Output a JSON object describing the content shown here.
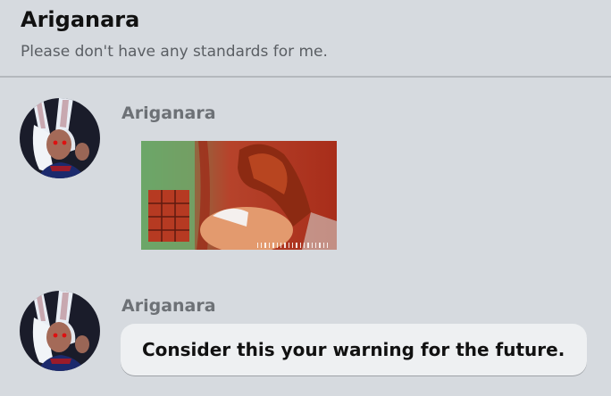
{
  "header": {
    "title": "Ariganara",
    "subtitle": "Please don't have any standards for me."
  },
  "messages": [
    {
      "sender": "Ariganara",
      "attachment": "image",
      "avatar_icon": "user-avatar"
    },
    {
      "sender": "Ariganara",
      "text": "Consider this your warning for the future.",
      "avatar_icon": "user-avatar"
    }
  ],
  "colors": {
    "background": "#d6dadf",
    "bubble": "#eef0f2",
    "divider": "#b4b8bd",
    "sender_text": "#6d7176"
  }
}
